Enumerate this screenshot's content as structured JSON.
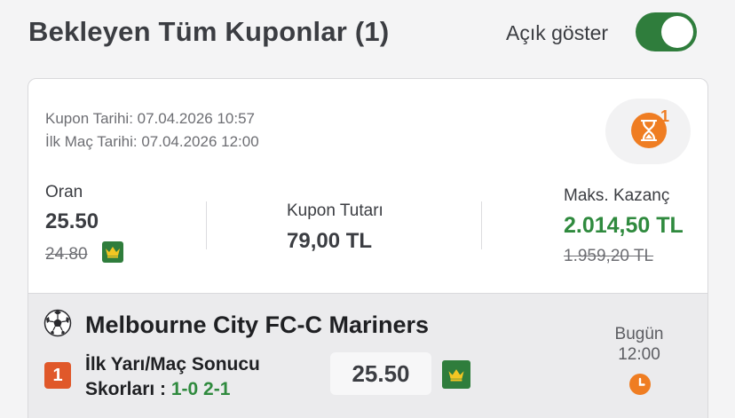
{
  "header": {
    "title": "Bekleyen Tüm Kuponlar (1)",
    "toggle_label": "Açık göster",
    "toggle_on": true
  },
  "coupon": {
    "date": "Kupon Tarihi: 07.04.2026 10:57",
    "first_match_date": "İlk Maç Tarihi: 07.04.2026 12:00",
    "timer_count": "1",
    "odds_label": "Oran",
    "odds_value": "25.50",
    "odds_old": "24.80",
    "amount_label": "Kupon Tutarı",
    "amount_value": "79,00 TL",
    "max_label": "Maks. Kazanç",
    "max_value": "2.014,50 TL",
    "max_old": "1.959,20 TL"
  },
  "match": {
    "title": "Melbourne City FC-C Mariners",
    "bet_number": "1",
    "market_line1": "İlk Yarı/Maç Sonucu",
    "market_line2": "Skorları : ",
    "pick": "1-0 2-1",
    "odds": "25.50",
    "day": "Bugün",
    "time": "12:00"
  },
  "colors": {
    "accent_green": "#2f7d3c",
    "win_green": "#2f8a3e",
    "orange": "#ef7d22",
    "bet_badge": "#e0582a"
  },
  "icons": [
    "hourglass-icon",
    "crown-icon",
    "soccer-ball-icon",
    "clock-icon"
  ]
}
